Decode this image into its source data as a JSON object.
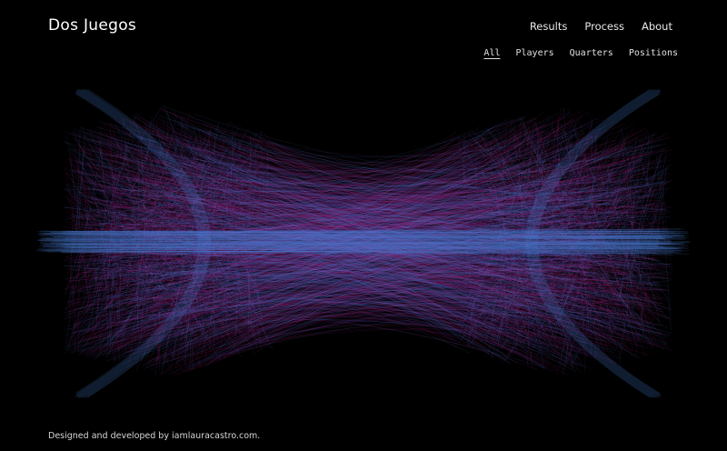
{
  "header": {
    "title": "Dos Juegos",
    "nav": [
      "Results",
      "Process",
      "About"
    ]
  },
  "filters": {
    "items": [
      "All",
      "Players",
      "Quarters",
      "Positions"
    ],
    "active": "All"
  },
  "footer": {
    "credit": "Designed and developed by iamlauracastro.com."
  },
  "colors": {
    "background": "#000000",
    "line_blue": "#4a7fd6",
    "line_magenta": "#c2187a",
    "line_purple": "#7a3fc0"
  }
}
